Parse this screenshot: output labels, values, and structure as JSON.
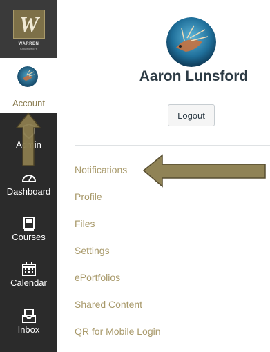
{
  "logo": {
    "letter": "W",
    "line1": "WARREN",
    "line2": "COMMUNITY"
  },
  "global_nav": {
    "account": {
      "label": "Account",
      "icon": "avatar-icon"
    },
    "admin": {
      "label": "Admin",
      "icon": "shield-icon"
    },
    "dashboard": {
      "label": "Dashboard",
      "icon": "speedometer-icon"
    },
    "courses": {
      "label": "Courses",
      "icon": "book-icon"
    },
    "calendar": {
      "label": "Calendar",
      "icon": "calendar-icon"
    },
    "inbox": {
      "label": "Inbox",
      "icon": "inbox-icon"
    }
  },
  "profile": {
    "name": "Aaron Lunsford",
    "logout_label": "Logout"
  },
  "account_menu": [
    {
      "label": "Notifications"
    },
    {
      "label": "Profile"
    },
    {
      "label": "Files"
    },
    {
      "label": "Settings"
    },
    {
      "label": "ePortfolios"
    },
    {
      "label": "Shared Content"
    },
    {
      "label": "QR for Mobile Login"
    }
  ],
  "colors": {
    "nav_bg": "#2b2b2b",
    "brand_gold": "#8b7d52",
    "link_color": "#a8996a",
    "arrow_fill": "#8b7d4e"
  }
}
